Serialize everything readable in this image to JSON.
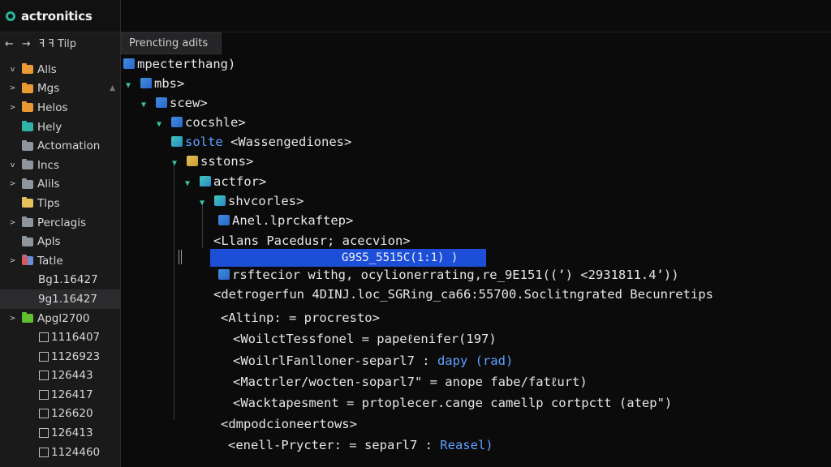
{
  "app": {
    "title": "actronitics"
  },
  "nav": {
    "back": "←",
    "forward": "→",
    "path": "ꟻ ꟻ Tilp"
  },
  "sidebar": {
    "items": [
      {
        "label": "Alls",
        "toggle": "v",
        "icon": "orange"
      },
      {
        "label": "Mgs",
        "toggle": ">",
        "icon": "orange"
      },
      {
        "label": "Helos",
        "toggle": ">",
        "icon": "orange"
      },
      {
        "label": "Hely",
        "toggle": "",
        "icon": "teal"
      },
      {
        "label": "Actomation",
        "toggle": "",
        "icon": "gray"
      },
      {
        "label": "Incs",
        "toggle": "v",
        "icon": "gray"
      },
      {
        "label": "Alils",
        "toggle": ">",
        "icon": "gray"
      },
      {
        "label": "Tlps",
        "toggle": "",
        "icon": "yellow"
      },
      {
        "label": "Perclagis",
        "toggle": ">",
        "icon": "gray"
      },
      {
        "label": "Apls",
        "toggle": "",
        "icon": "gray"
      },
      {
        "label": "Tatle",
        "toggle": ">",
        "icon": "redblue"
      }
    ],
    "plain_items": [
      "Bg1.16427",
      "9g1.16427"
    ],
    "group": {
      "label": "Apgl2700",
      "toggle": ">",
      "icon": "green"
    },
    "files": [
      "1116407",
      "1126923",
      "126443",
      "126417",
      "126620",
      "126413",
      "1124460"
    ]
  },
  "tab": {
    "label": "Prencting adits"
  },
  "xml_lines": [
    {
      "arrow": "",
      "icon": "b",
      "text": "mpecterthang)"
    },
    {
      "arrow": "▼",
      "icon": "b",
      "text": "mbs>"
    },
    {
      "arrow": "▼",
      "icon": "b",
      "text": "scew>"
    },
    {
      "arrow": "▼",
      "icon": "b",
      "text": "cocshle>"
    },
    {
      "arrow": "",
      "icon": "t",
      "text": "",
      "hl": "solte",
      "rest": "  <Wassengediones>"
    },
    {
      "arrow": "▼",
      "icon": "y",
      "text": "sstons>"
    },
    {
      "arrow": "▼",
      "icon": "t",
      "text": "actfor>"
    },
    {
      "arrow": "▼",
      "icon": "t",
      "text": "shvcorles>"
    },
    {
      "arrow": "",
      "icon": "b",
      "text": "Anel.lprckaftep>"
    },
    {
      "arrow": "",
      "icon": "",
      "text": "<Llans Pacedusr; acecvion>"
    },
    {
      "arrow": "",
      "icon": "",
      "text": ""
    },
    {
      "arrow": "",
      "icon": "b",
      "text": "rsftecior withg, ocylionerrating,re_9E151((ʼ) <2931811.4ʼ))"
    },
    {
      "arrow": "",
      "icon": "",
      "text": "<detrogerfun 4DINJ.loc_SGRing_ca66:55700.Soclitngrated Becunretips"
    },
    {
      "arrow": "",
      "icon": "",
      "text": "<Altinp: = procresto>"
    },
    {
      "arrow": "",
      "icon": "",
      "text": "<WoilctTessfonel = papeℓenifer(197)"
    },
    {
      "arrow": "",
      "icon": "",
      "text": "<WoilrlFanlloner-separl7 : ",
      "hl2": "dapy (rad)"
    },
    {
      "arrow": "",
      "icon": "",
      "text": "<Mactrler/wocten-soparl7\" = anope fabe/fatℓurt)"
    },
    {
      "arrow": "",
      "icon": "",
      "text": "<Wacktapesment = prtoplecer.cange camellp cortpctt (atep\")"
    },
    {
      "arrow": "",
      "icon": "",
      "text": "<dmpodcioneertows>"
    },
    {
      "arrow": "",
      "icon": "",
      "text": "<enell-Prycter: = separl7 :  ",
      "hl2": "Reasel)"
    }
  ],
  "selected_line": {
    "text": "G9S5_5515C(1:1)  )"
  },
  "colors": {
    "accent": "#1d4ed8",
    "tree_arrow": "#39c2a3",
    "sidebar_bg": "#1a1a1b",
    "main_bg": "#0b0b0c"
  }
}
